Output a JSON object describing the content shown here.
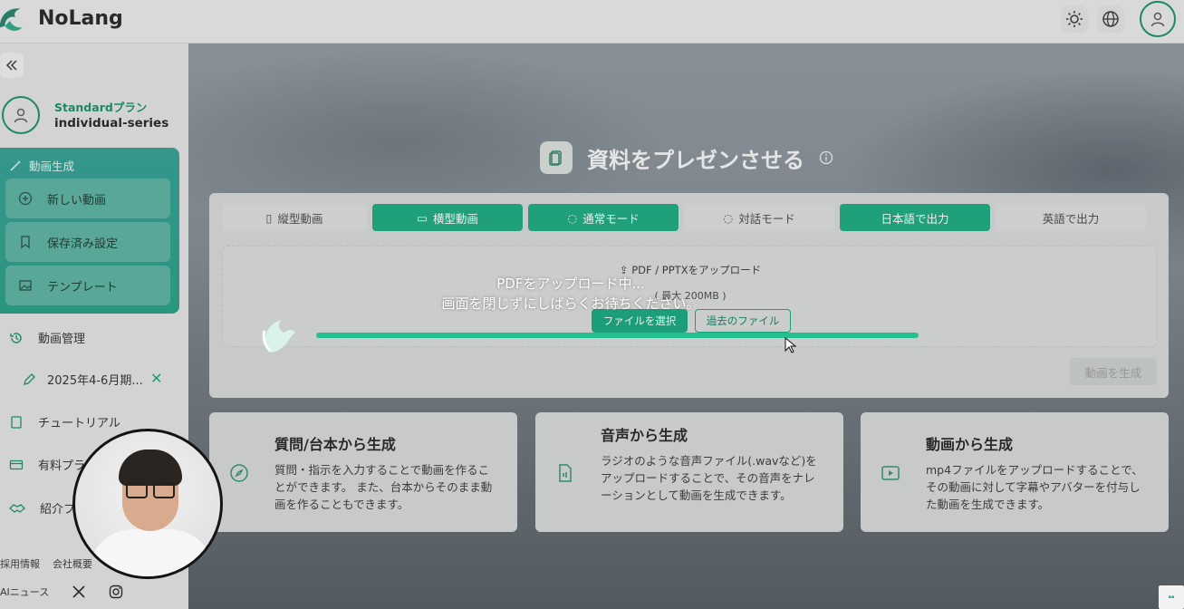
{
  "app": {
    "name": "NoLang"
  },
  "topbar": {
    "icons": [
      "sun-icon",
      "globe-icon",
      "user-icon"
    ]
  },
  "sidebar": {
    "plan": {
      "name": "Standardプラン",
      "series": "individual-series"
    },
    "generate_group": {
      "title": "動画生成",
      "items": [
        {
          "label": "新しい動画",
          "icon": "plus-circle-icon"
        },
        {
          "label": "保存済み設定",
          "icon": "bookmark-icon"
        },
        {
          "label": "テンプレート",
          "icon": "image-icon"
        }
      ]
    },
    "nav": [
      {
        "label": "動画管理",
        "icon": "history-icon"
      },
      {
        "label": "2025年4-6月期...",
        "icon": "pencil-icon"
      },
      {
        "label": "チュートリアル",
        "icon": "book-icon"
      },
      {
        "label": "有料プラ",
        "icon": "card-icon"
      },
      {
        "label": "紹介プ",
        "icon": "handshake-icon"
      }
    ],
    "footer": {
      "links": [
        "採用情報",
        "会社概要"
      ],
      "news": "AIニュース"
    }
  },
  "main": {
    "title": "資料をプレゼンさせる",
    "toggles": [
      {
        "label": "縦型動画",
        "active": false
      },
      {
        "label": "横型動画",
        "active": true
      },
      {
        "label": "通常モード",
        "active": true
      },
      {
        "label": "対話モード",
        "active": false
      },
      {
        "label": "日本語で出力",
        "active": true
      },
      {
        "label": "英語で出力",
        "active": false
      }
    ],
    "upload": {
      "heading": "PDF / PPTXをアップロード",
      "size_note": "( 最大 200MB )",
      "select_button": "ファイルを選択",
      "past_button": "過去のファイル"
    },
    "generate_button": "動画を生成",
    "cards": [
      {
        "title": "質問/台本から生成",
        "desc": "質問・指示を入力することで動画を作ることができます。 また、台本からそのまま動画を作ることもできます。",
        "icon": "compass-icon"
      },
      {
        "title": "音声から生成",
        "desc": "ラジオのような音声ファイル(.wavなど)をアップロードすることで、その音声をナレーションとして動画を生成できます。",
        "icon": "audio-file-icon"
      },
      {
        "title": "動画から生成",
        "desc": "mp4ファイルをアップロードすることで、その動画に対して字幕やアバターを付与した動画を生成できます。",
        "icon": "video-icon"
      }
    ]
  },
  "upload_overlay": {
    "line1": "PDFをアップロード中...",
    "line2": "画面を閉じずにしばらくお待ちください。",
    "progress_percent": 100
  },
  "colors": {
    "accent": "#13a57a",
    "brand_dark": "#0f8a66",
    "progress": "#23c08f"
  }
}
